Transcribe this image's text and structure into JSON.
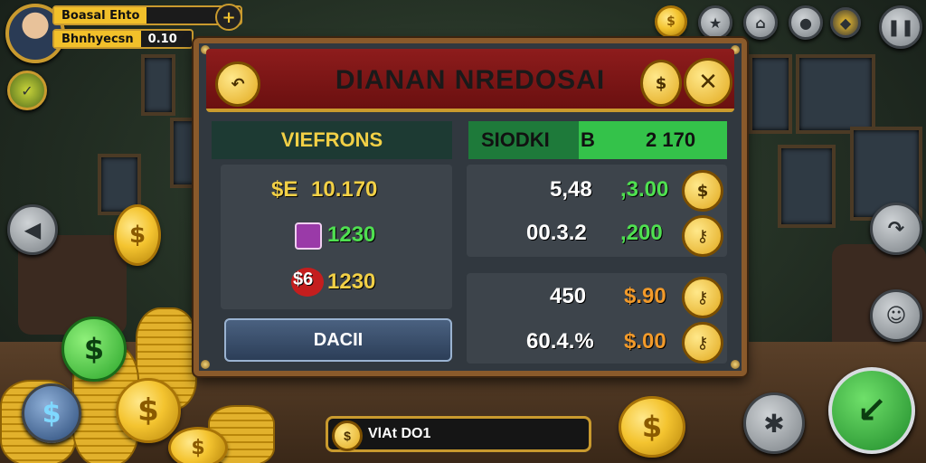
{
  "player": {
    "name": "Boasal Ehto",
    "balance_label": "Bhnhyecsn",
    "balance_value": "0.10"
  },
  "top_right_icons": [
    "coin-icon",
    "badge-icon",
    "home-icon",
    "gamepad-icon",
    "shield-coin-icon",
    "pause-icon"
  ],
  "panel": {
    "title": "DIANAN NREDOSAI",
    "left_tab": "VIEFRONS",
    "right_tab": "SIODKI",
    "right_tab_letter": "B",
    "right_tab_value": "2 170",
    "left_rows": [
      {
        "label": "$E",
        "value": "10.170"
      },
      {
        "label": "",
        "value": "1230"
      },
      {
        "label": "$6",
        "value": "1230"
      }
    ],
    "right_rows": [
      {
        "left": "5,48",
        "right": ",3.00"
      },
      {
        "left": "00.3.2",
        "right": ",200"
      },
      {
        "left": "450",
        "right": "$.90"
      },
      {
        "left": "60.4.%",
        "right": "$.00"
      }
    ],
    "action_button": "DACII"
  },
  "bottom_bar": {
    "label": "VlAt DO1"
  },
  "colors": {
    "header_red": "#8e1c1c",
    "accent_gold": "#c99a2e",
    "tab_green": "#34c24a",
    "value_yellow": "#f2d046",
    "value_green": "#4fe050"
  }
}
